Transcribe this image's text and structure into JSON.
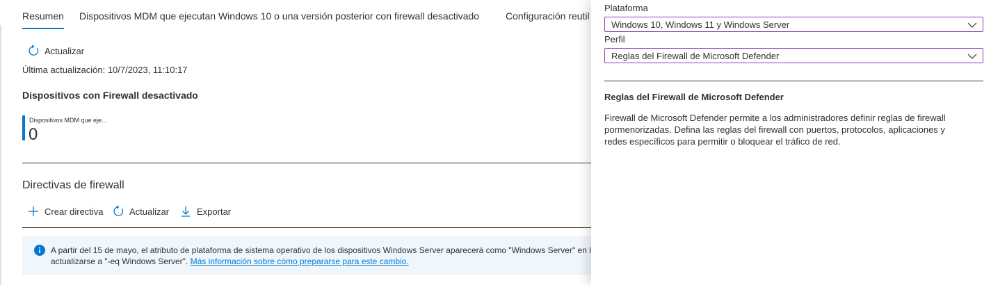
{
  "tabs": [
    {
      "label": "Resumen",
      "active": true
    },
    {
      "label": "Dispositivos MDM que ejecutan Windows 10 o una versión posterior con firewall desactivado",
      "active": false
    },
    {
      "label": "Configuración reutil",
      "active": false
    }
  ],
  "toolbar_top": {
    "refresh_label": "Actualizar"
  },
  "last_update": "Última actualización: 10/7/2023, 11:10:17",
  "devices_section": {
    "title": "Dispositivos con Firewall desactivado",
    "tile_label": "Dispositivos MDM que eje...",
    "tile_value": "0"
  },
  "policies_section": {
    "title": "Directivas de firewall",
    "create_label": "Crear directiva",
    "refresh_label": "Actualizar",
    "export_label": "Exportar"
  },
  "info_banner": {
    "line1": "A partir del 15 de mayo, el atributo de plataforma de sistema operativo de los dispositivos Windows Server aparecerá como \"Windows Server\" en lu",
    "line2": "actualizarse a \"-eq Windows Server\".",
    "link": "Más información sobre cómo prepararse para este cambio."
  },
  "panel": {
    "platform_label": "Plataforma",
    "platform_value": "Windows 10, Windows 11 y Windows Server",
    "profile_label": "Perfil",
    "profile_value": "Reglas del Firewall de Microsoft Defender",
    "heading": "Reglas del Firewall de Microsoft Defender",
    "description": "Firewall de Microsoft Defender permite a los administradores definir reglas de firewall pormenorizadas. Defina las reglas del firewall con puertos, protocolos, aplicaciones y redes específicos para permitir o bloquear el tráfico de red."
  },
  "colors": {
    "accent": "#0078d4",
    "select_border": "#8a3eb5",
    "info_bg": "#eff6fc"
  }
}
